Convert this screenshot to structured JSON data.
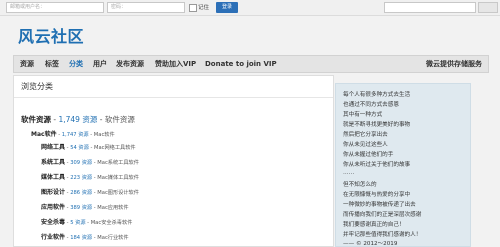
{
  "topbar": {
    "email_placeholder": "邮箱或用户名：",
    "password_placeholder": "密码：",
    "remember_label": "记住",
    "login_label": "登录"
  },
  "site": {
    "logo": "风云社区"
  },
  "nav": {
    "items": [
      {
        "label": "资源"
      },
      {
        "label": "标签"
      },
      {
        "label": "分类"
      },
      {
        "label": "用户"
      },
      {
        "label": "发布资源"
      },
      {
        "label": "赞助加入VIP"
      },
      {
        "label": "Donate to join VIP"
      }
    ],
    "right_label": "微云提供存储服务"
  },
  "main": {
    "title": "浏览分类",
    "root": {
      "name": "软件资源",
      "sep": " - ",
      "count": "1,749 资源",
      "suffix": " - 软件资源"
    },
    "sub": {
      "name": "Mac软件",
      "sep": " - ",
      "count": "1,747 资源",
      "suffix": " - Mac软件"
    },
    "items": [
      {
        "name": "网络工具",
        "count": "54 资源",
        "desc": "Mac网络工具软件"
      },
      {
        "name": "系统工具",
        "count": "309 资源",
        "desc": "Mac系统工具软件"
      },
      {
        "name": "媒体工具",
        "count": "223 资源",
        "desc": "Mac媒体工具软件"
      },
      {
        "name": "图形设计",
        "count": "286 资源",
        "desc": "Mac图形设计软件"
      },
      {
        "name": "应用软件",
        "count": "389 资源",
        "desc": "Mac应用软件"
      },
      {
        "name": "安全杀毒",
        "count": "5 资源",
        "desc": "Mac安全杀毒软件"
      },
      {
        "name": "行业软件",
        "count": "184 资源",
        "desc": "Mac行业软件"
      }
    ]
  },
  "sidebar": {
    "lines": [
      "每个人有很多种方式去生活",
      "也通过不同方式去感恩",
      "其中有一种方式",
      "就是不断寻找更美好的事物",
      "然后把它分享出去",
      "你从未见过这些人",
      "你从未握过他们的手",
      "你从未听过关于他们的故事",
      "……",
      "但不知怎么的",
      "在无限慷慨与热爱的分享中",
      "一种微妙的事物被传递了出去",
      "而传播向我们的正是深层次感谢",
      "我们要感谢真正的自己！",
      "并牢记那些值得我们感谢的人！",
      "—— © 2012～2019"
    ]
  },
  "colors": {
    "accent": "#1f6fb2",
    "login_button": "#2c6fb7",
    "sidebar_bg": "#dfe9ef"
  }
}
